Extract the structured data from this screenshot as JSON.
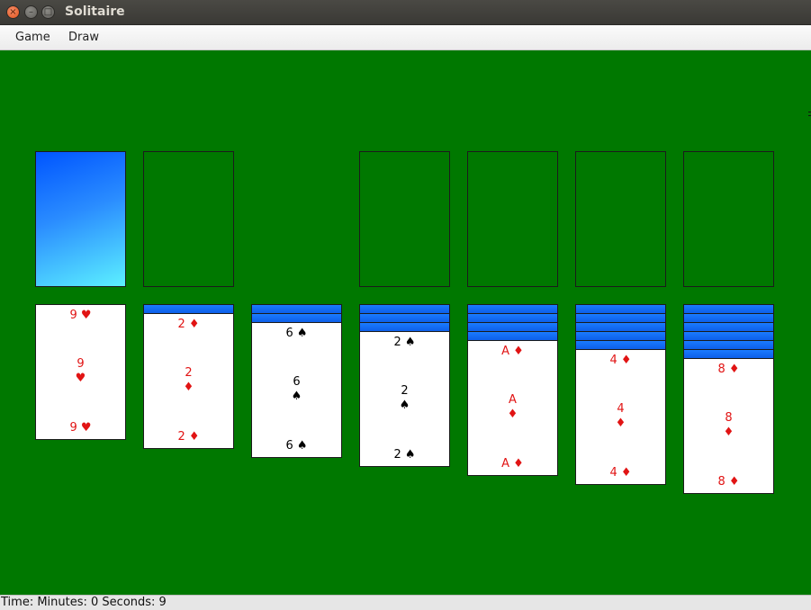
{
  "window": {
    "title": "Solitaire"
  },
  "menu": {
    "game": "Game",
    "draw": "Draw"
  },
  "colors": {
    "felt": "#007800",
    "card_back": "#0d5fe9",
    "red_suit": "#e11414",
    "black_suit": "#000000"
  },
  "tableau": [
    {
      "face_down": 0,
      "rank": "9",
      "suit": "♥",
      "color": "red"
    },
    {
      "face_down": 1,
      "rank": "2",
      "suit": "♦",
      "color": "red"
    },
    {
      "face_down": 2,
      "rank": "6",
      "suit": "♠",
      "color": "black"
    },
    {
      "face_down": 3,
      "rank": "2",
      "suit": "♠",
      "color": "black"
    },
    {
      "face_down": 4,
      "rank": "A",
      "suit": "♦",
      "color": "red"
    },
    {
      "face_down": 5,
      "rank": "4",
      "suit": "♦",
      "color": "red"
    },
    {
      "face_down": 6,
      "rank": "8",
      "suit": "♦",
      "color": "red"
    }
  ],
  "status": {
    "text": "Time: Minutes: 0 Seconds: 9"
  }
}
